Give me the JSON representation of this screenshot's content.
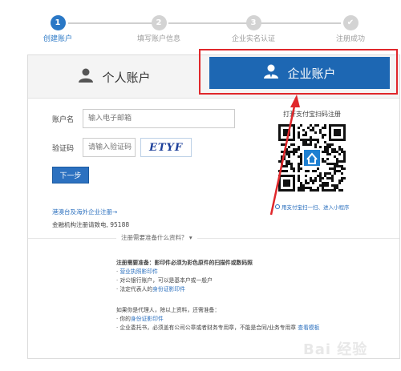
{
  "steps": [
    {
      "num": "1",
      "label": "创建账户",
      "state": "active"
    },
    {
      "num": "2",
      "label": "填写账户信息",
      "state": "pending"
    },
    {
      "num": "3",
      "label": "企业实名认证",
      "state": "pending"
    },
    {
      "num": "✔",
      "label": "注册成功",
      "state": "pending"
    }
  ],
  "tabs": {
    "personal": "个人账户",
    "enterprise": "企业账户"
  },
  "form": {
    "account_label": "账户名",
    "account_placeholder": "输入电子邮箱",
    "captcha_label": "验证码",
    "captcha_placeholder": "请输入验证码",
    "captcha_text": "ETYF",
    "next_button": "下一步"
  },
  "links": {
    "hk_register": "港澳台及海外企业注册→",
    "financial": "金融机构注册请致电, 95188"
  },
  "qr": {
    "title": "打开支付宝扫码注册",
    "note": "用支付宝扫一扫、进入小程序"
  },
  "materials": {
    "toggle": "注册需要准备什么资料？",
    "intro": "注册需要准备：影印件必须为彩色原件的扫描件或数码照",
    "item1": "营业执照影印件",
    "item2": "对公银行账户，可以是基本户或一般户",
    "item3_prefix": "法定代表人的",
    "item3_link": "身份证影印件",
    "agent_intro": "如果你是代理人，除以上资料，还需准备：",
    "agent1_prefix": "你的",
    "agent1_link": "身份证影印件",
    "agent2_text": "企业委托书，必须盖有公司公章或者财务专用章，不能是合同/业务专用章",
    "agent2_link": "查看模板"
  },
  "watermark": "Bai 经验",
  "colors": {
    "accent": "#2a78c6",
    "tab_active": "#1d67b3",
    "highlight": "#e0272b",
    "link": "#2a6fbe"
  },
  "icons": [
    "user-icon",
    "business-user-icon",
    "info-icon"
  ]
}
